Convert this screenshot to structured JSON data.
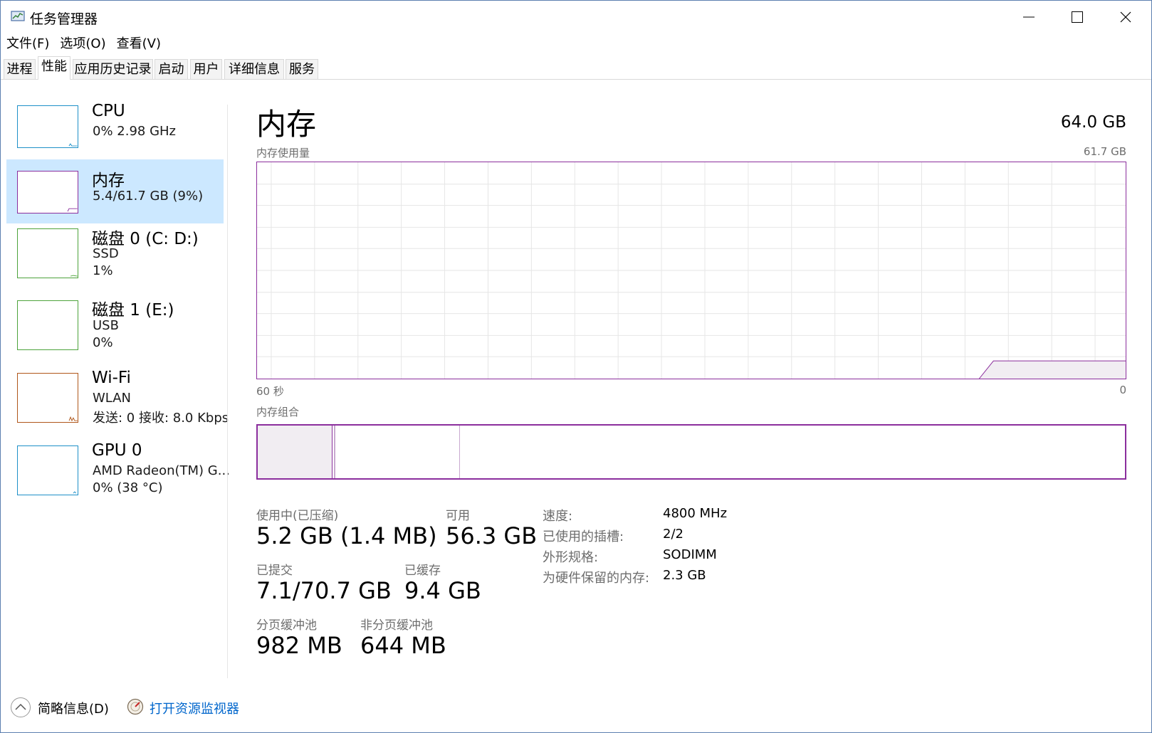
{
  "window": {
    "title": "任务管理器"
  },
  "menu": [
    "文件(F)",
    "选项(O)",
    "查看(V)"
  ],
  "tabs": [
    "进程",
    "性能",
    "应用历史记录",
    "启动",
    "用户",
    "详细信息",
    "服务"
  ],
  "active_tab": "性能",
  "sidebar": {
    "items": [
      {
        "title": "CPU",
        "sub1": "0%  2.98 GHz",
        "sub2": "",
        "color": "#1e90c8"
      },
      {
        "title": "内存",
        "sub1": "5.4/61.7 GB (9%)",
        "sub2": "",
        "color": "#8b2e9d"
      },
      {
        "title": "磁盘 0 (C: D:)",
        "sub1": "SSD",
        "sub2": "1%",
        "color": "#4da33b"
      },
      {
        "title": "磁盘 1 (E:)",
        "sub1": "USB",
        "sub2": "0%",
        "color": "#4da33b"
      },
      {
        "title": "Wi-Fi",
        "sub1": "WLAN",
        "sub2": "发送: 0  接收: 8.0 Kbps",
        "color": "#b0571b"
      },
      {
        "title": "GPU 0",
        "sub1": "AMD Radeon(TM) G...",
        "sub2": "0%  (38 °C)",
        "color": "#1e90c8"
      }
    ],
    "selected": "内存"
  },
  "main": {
    "title": "内存",
    "total": "64.0 GB",
    "usage_label": "内存使用量",
    "usage_max": "61.7 GB",
    "time_left": "60 秒",
    "time_right": "0",
    "composition_label": "内存组合",
    "stats": {
      "in_use_label": "使用中(已压缩)",
      "in_use_value": "5.2 GB (1.4 MB)",
      "available_label": "可用",
      "available_value": "56.3 GB",
      "committed_label": "已提交",
      "committed_value": "7.1/70.7 GB",
      "cached_label": "已缓存",
      "cached_value": "9.4 GB",
      "paged_label": "分页缓冲池",
      "paged_value": "982 MB",
      "nonpaged_label": "非分页缓冲池",
      "nonpaged_value": "644 MB"
    },
    "details": [
      {
        "label": "速度:",
        "value": "4800 MHz"
      },
      {
        "label": "已使用的插槽:",
        "value": "2/2"
      },
      {
        "label": "外形规格:",
        "value": "SODIMM"
      },
      {
        "label": "为硬件保留的内存:",
        "value": "2.3 GB"
      }
    ]
  },
  "footer": {
    "fewer_details": "简略信息(D)",
    "open_monitor": "打开资源监视器"
  },
  "colors": {
    "memory": "#8b2e9d",
    "selection": "#cce8ff",
    "link": "#0066cc"
  }
}
